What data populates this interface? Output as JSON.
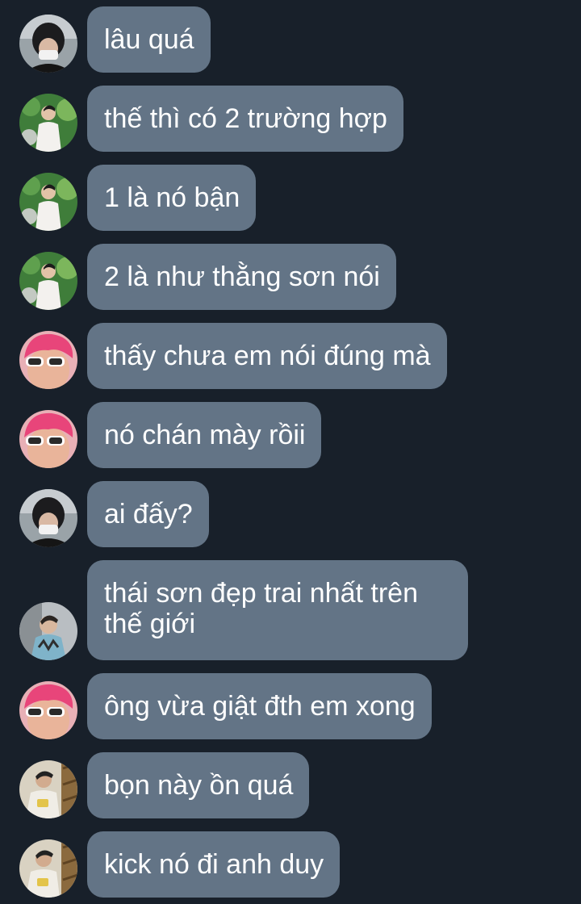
{
  "messages": [
    {
      "avatar": "masked-person-avatar",
      "text": "lâu quá"
    },
    {
      "avatar": "garden-person-avatar",
      "text": "thế thì có 2 trường hợp"
    },
    {
      "avatar": "garden-person-avatar",
      "text": "1 là nó bận"
    },
    {
      "avatar": "garden-person-avatar",
      "text": "2 là như thằng sơn nói"
    },
    {
      "avatar": "pink-hair-sunglasses-avatar",
      "text": "thấy chưa em nói đúng mà"
    },
    {
      "avatar": "pink-hair-sunglasses-avatar",
      "text": "nó chán mày rồii"
    },
    {
      "avatar": "masked-person-avatar",
      "text": "ai đấy?"
    },
    {
      "avatar": "street-person-avatar",
      "text": "thái sơn đẹp trai nhất trên thế giới"
    },
    {
      "avatar": "pink-hair-sunglasses-avatar",
      "text": "ông vừa giật đth em xong"
    },
    {
      "avatar": "mirror-selfie-avatar",
      "text": "bọn này ồn quá"
    },
    {
      "avatar": "mirror-selfie-avatar",
      "text": "kick nó đi anh duy"
    }
  ],
  "colors": {
    "background": "#18202a",
    "bubble": "#637486",
    "text": "#ffffff"
  }
}
